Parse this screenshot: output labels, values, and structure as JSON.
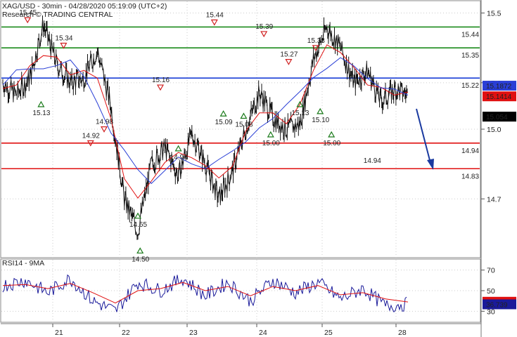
{
  "header": {
    "title": "XAG/USD - 30min - 04/28/2020 05:19:09 (UTC+2)",
    "subtitle": "Research © TRADING CENTRAL"
  },
  "colors": {
    "resistance": "#1a8a1a",
    "pivot": "#1a3fd6",
    "support": "#e01010",
    "price": "#111111",
    "ma_fast": "#e01010",
    "ma_slow": "#2a3fd6",
    "rsi": "#1a1a9a",
    "rsi_ma": "#e01010",
    "up_marker": "#1a7a1a",
    "down_marker": "#d02020",
    "arrow": "#1a3aa0",
    "current_box": "#000000"
  },
  "chart_data": [
    {
      "type": "line",
      "title": "XAG/USD - 30min - 04/28/2020 05:19:09 (UTC+2)",
      "x_ticks": [
        "21",
        "22",
        "23",
        "24",
        "25",
        "28"
      ],
      "y_ticks": [
        14.7,
        15.0,
        15.2,
        15.5
      ],
      "ylim": [
        14.45,
        15.55
      ],
      "levels": [
        {
          "value": 15.44,
          "label": "15.44",
          "role": "resistance"
        },
        {
          "value": 15.35,
          "label": "15.35",
          "role": "resistance"
        },
        {
          "value": 15.22,
          "label": "15.22",
          "role": "pivot"
        },
        {
          "value": 14.94,
          "label": "14.94",
          "role": "support"
        },
        {
          "value": 14.83,
          "label": "14.83",
          "role": "support"
        }
      ],
      "price_boxes": [
        {
          "value": 15.1872,
          "label": "15.1872",
          "role": "ma_slow"
        },
        {
          "value": 15.1414,
          "label": "15.1414",
          "role": "ma_fast"
        },
        {
          "value": 15.054,
          "label": "15.054",
          "role": "current"
        }
      ],
      "series": [
        {
          "key": "price",
          "x": [
            0,
            0.3,
            0.6,
            0.9,
            1.2,
            1.5,
            1.8,
            2.1,
            2.4,
            2.7,
            3.0,
            3.3,
            3.6,
            3.9,
            4.2,
            4.5,
            4.8,
            5.1,
            5.4,
            5.7,
            6.0,
            6.3,
            6.6,
            6.9,
            7.2,
            7.5,
            7.8,
            8.1,
            8.4,
            8.7,
            9.0
          ],
          "y": [
            15.2,
            15.15,
            15.22,
            15.45,
            15.28,
            15.2,
            15.22,
            15.34,
            15.1,
            14.7,
            14.56,
            14.85,
            14.92,
            14.8,
            14.98,
            14.85,
            14.7,
            14.82,
            15.0,
            15.16,
            15.05,
            15.0,
            15.02,
            15.3,
            15.44,
            15.35,
            15.2,
            15.25,
            15.12,
            15.17,
            15.15
          ]
        }
      ],
      "annotations": [
        {
          "x": 0.55,
          "y": 15.45,
          "label": "15.45",
          "kind": "top"
        },
        {
          "x": 0.85,
          "y": 15.13,
          "label": "15.13",
          "kind": "bottom"
        },
        {
          "x": 1.35,
          "y": 15.34,
          "label": "15.34",
          "kind": "top"
        },
        {
          "x": 1.95,
          "y": 14.92,
          "label": "14.92",
          "kind": "top"
        },
        {
          "x": 2.25,
          "y": 14.98,
          "label": "14.98",
          "kind": "top"
        },
        {
          "x": 3.0,
          "y": 14.65,
          "label": "14.65",
          "kind": "bottom"
        },
        {
          "x": 3.05,
          "y": 14.5,
          "label": "14.50",
          "kind": "bottom"
        },
        {
          "x": 3.5,
          "y": 15.16,
          "label": "15.16",
          "kind": "top"
        },
        {
          "x": 3.9,
          "y": 14.94,
          "label": "14.94",
          "kind": "bottom"
        },
        {
          "x": 4.7,
          "y": 15.44,
          "label": "15.44",
          "kind": "top"
        },
        {
          "x": 4.9,
          "y": 15.09,
          "label": "15.09",
          "kind": "bottom"
        },
        {
          "x": 5.35,
          "y": 15.08,
          "label": "15.08",
          "kind": "bottom"
        },
        {
          "x": 5.8,
          "y": 15.39,
          "label": "15.39",
          "kind": "top"
        },
        {
          "x": 5.95,
          "y": 15.0,
          "label": "15.00",
          "kind": "bottom"
        },
        {
          "x": 6.35,
          "y": 15.27,
          "label": "15.27",
          "kind": "top"
        },
        {
          "x": 6.6,
          "y": 15.13,
          "label": "15.13",
          "kind": "bottom"
        },
        {
          "x": 6.95,
          "y": 15.33,
          "label": "15.33",
          "kind": "top"
        },
        {
          "x": 7.05,
          "y": 15.1,
          "label": "15.10",
          "kind": "bottom"
        },
        {
          "x": 7.3,
          "y": 15.0,
          "label": "15.00",
          "kind": "bottom"
        },
        {
          "x": 8.2,
          "y": 14.94,
          "label": "14.94",
          "kind": "target"
        }
      ]
    },
    {
      "type": "line",
      "title": "RSI14 - 9MA",
      "ylim": [
        20,
        80
      ],
      "y_ticks": [
        30,
        50,
        70
      ],
      "series": [
        {
          "key": "rsi",
          "name": "RSI14",
          "x": [
            0,
            0.5,
            1,
            1.5,
            2,
            2.5,
            3,
            3.5,
            4,
            4.5,
            5,
            5.5,
            6,
            6.5,
            7,
            7.5,
            8,
            8.5,
            9
          ],
          "y": [
            55,
            60,
            48,
            62,
            40,
            30,
            58,
            50,
            62,
            45,
            58,
            40,
            60,
            48,
            58,
            42,
            52,
            35,
            37
          ]
        },
        {
          "key": "rsi_ma",
          "name": "9MA",
          "x": [
            0,
            0.5,
            1,
            1.5,
            2,
            2.5,
            3,
            3.5,
            4,
            4.5,
            5,
            5.5,
            6,
            6.5,
            7,
            7.5,
            8,
            8.5,
            9
          ],
          "y": [
            55,
            56,
            52,
            57,
            48,
            38,
            50,
            52,
            58,
            50,
            54,
            45,
            54,
            50,
            55,
            46,
            48,
            42,
            39
          ]
        }
      ],
      "price_boxes": [
        {
          "value": 39.2257,
          "label": "39.2257",
          "role": "rsi_ma"
        },
        {
          "value": 36.739,
          "label": "36.739",
          "role": "rsi"
        }
      ]
    }
  ]
}
